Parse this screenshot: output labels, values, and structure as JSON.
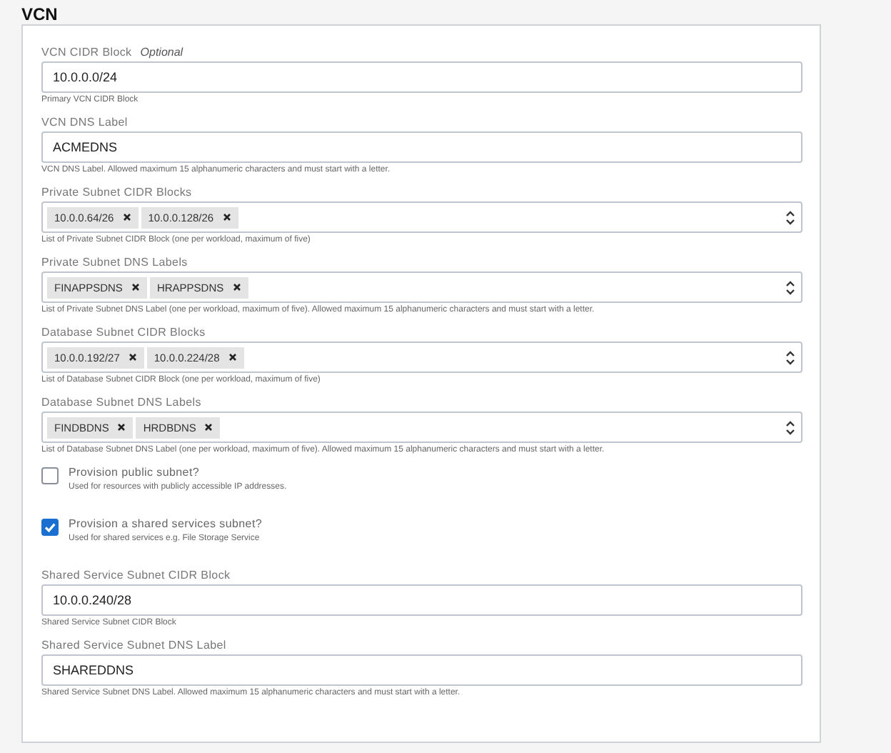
{
  "section_title": "VCN",
  "fields": [
    {
      "kind": "text",
      "label": "VCN CIDR Block",
      "optional_tag": "Optional",
      "value": "10.0.0.0/24",
      "help": "Primary VCN CIDR Block"
    },
    {
      "kind": "text",
      "label": "VCN DNS Label",
      "value": "ACMEDNS",
      "help": "VCN DNS Label. Allowed maximum 15 alphanumeric characters and must start with a letter."
    },
    {
      "kind": "tags",
      "label": "Private Subnet CIDR Blocks",
      "tags": [
        "10.0.0.64/26",
        "10.0.0.128/26"
      ],
      "help": "List of Private Subnet CIDR Block (one per workload, maximum of five)"
    },
    {
      "kind": "tags",
      "label": "Private Subnet DNS Labels",
      "tags": [
        "FINAPPSDNS",
        "HRAPPSDNS"
      ],
      "help": "List of Private Subnet DNS Label (one per workload, maximum of five). Allowed maximum 15 alphanumeric characters and must start with a letter."
    },
    {
      "kind": "tags",
      "label": "Database Subnet CIDR Blocks",
      "tags": [
        "10.0.0.192/27",
        "10.0.0.224/28"
      ],
      "help": "List of Database Subnet CIDR Block (one per workload, maximum of five)"
    },
    {
      "kind": "tags",
      "label": "Database Subnet DNS Labels",
      "tags": [
        "FINDBDNS",
        "HRDBDNS"
      ],
      "help": "List of Database Subnet DNS Label (one per workload, maximum of five). Allowed maximum 15 alphanumeric characters and must start with a letter."
    },
    {
      "kind": "checkbox",
      "label": "Provision public subnet?",
      "checked": false,
      "help": "Used for resources with publicly accessible IP addresses."
    },
    {
      "kind": "checkbox",
      "label": "Provision a shared services subnet?",
      "checked": true,
      "help": "Used for shared services e.g. File Storage Service"
    },
    {
      "kind": "text",
      "label": "Shared Service Subnet CIDR Block",
      "value": "10.0.0.240/28",
      "help": "Shared Service Subnet CIDR Block"
    },
    {
      "kind": "text",
      "label": "Shared Service Subnet DNS Label",
      "value": "SHAREDDNS",
      "help": "Shared Service Subnet DNS Label. Allowed maximum 15 alphanumeric characters and must start with a letter."
    }
  ]
}
